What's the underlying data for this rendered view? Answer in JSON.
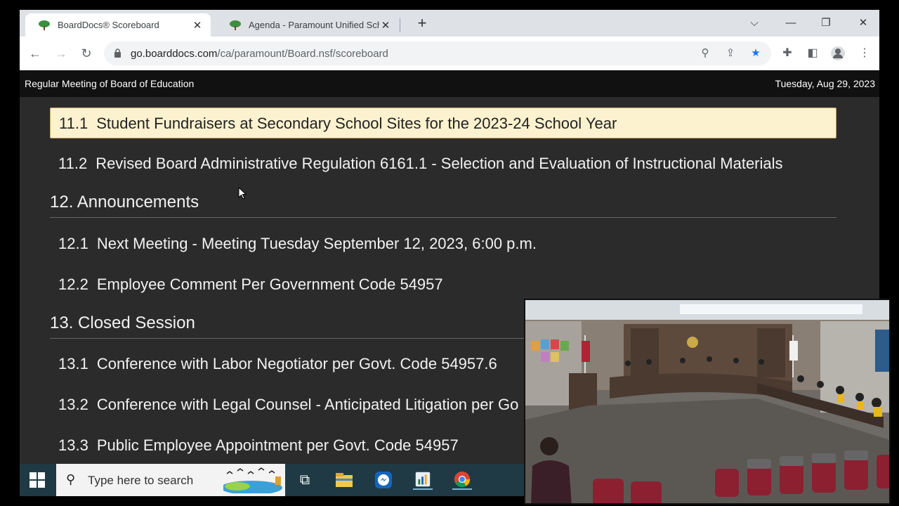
{
  "browser": {
    "tabs": [
      {
        "title": "BoardDocs® Scoreboard",
        "active": true
      },
      {
        "title": "Agenda - Paramount Unified Sch",
        "active": false
      }
    ],
    "url_host": "go.boarddocs.com",
    "url_path": "/ca/paramount/Board.nsf/scoreboard",
    "star_color": "#1a73e8"
  },
  "header": {
    "meeting_title": "Regular Meeting of Board of Education",
    "date": "Tuesday, Aug 29, 2023"
  },
  "agenda": {
    "items": [
      {
        "num": "11.1",
        "text": "Student Fundraisers at Secondary School Sites for the 2023-24 School Year",
        "highlighted": true
      },
      {
        "num": "11.2",
        "text": "Revised Board Administrative Regulation 6161.1 - Selection and Evaluation of Instructional Materials"
      }
    ],
    "section_12": "12. Announcements",
    "items_12": [
      {
        "num": "12.1",
        "text": "Next Meeting - Meeting Tuesday September 12, 2023, 6:00 p.m."
      },
      {
        "num": "12.2",
        "text": "Employee Comment Per Government Code 54957"
      }
    ],
    "section_13": "13. Closed Session",
    "items_13": [
      {
        "num": "13.1",
        "text": "Conference with Labor Negotiator per Govt. Code 54957.6"
      },
      {
        "num": "13.2",
        "text": "Conference with Legal Counsel - Anticipated Litigation per Go"
      },
      {
        "num": "13.3",
        "text": "Public Employee Appointment per Govt. Code 54957"
      }
    ],
    "highlight_color": "#fdf2cf"
  },
  "taskbar": {
    "search_placeholder": "Type here to search",
    "apps": [
      "task-view-icon",
      "file-explorer-icon",
      "messenger-icon",
      "app-icon",
      "chrome-icon"
    ]
  }
}
